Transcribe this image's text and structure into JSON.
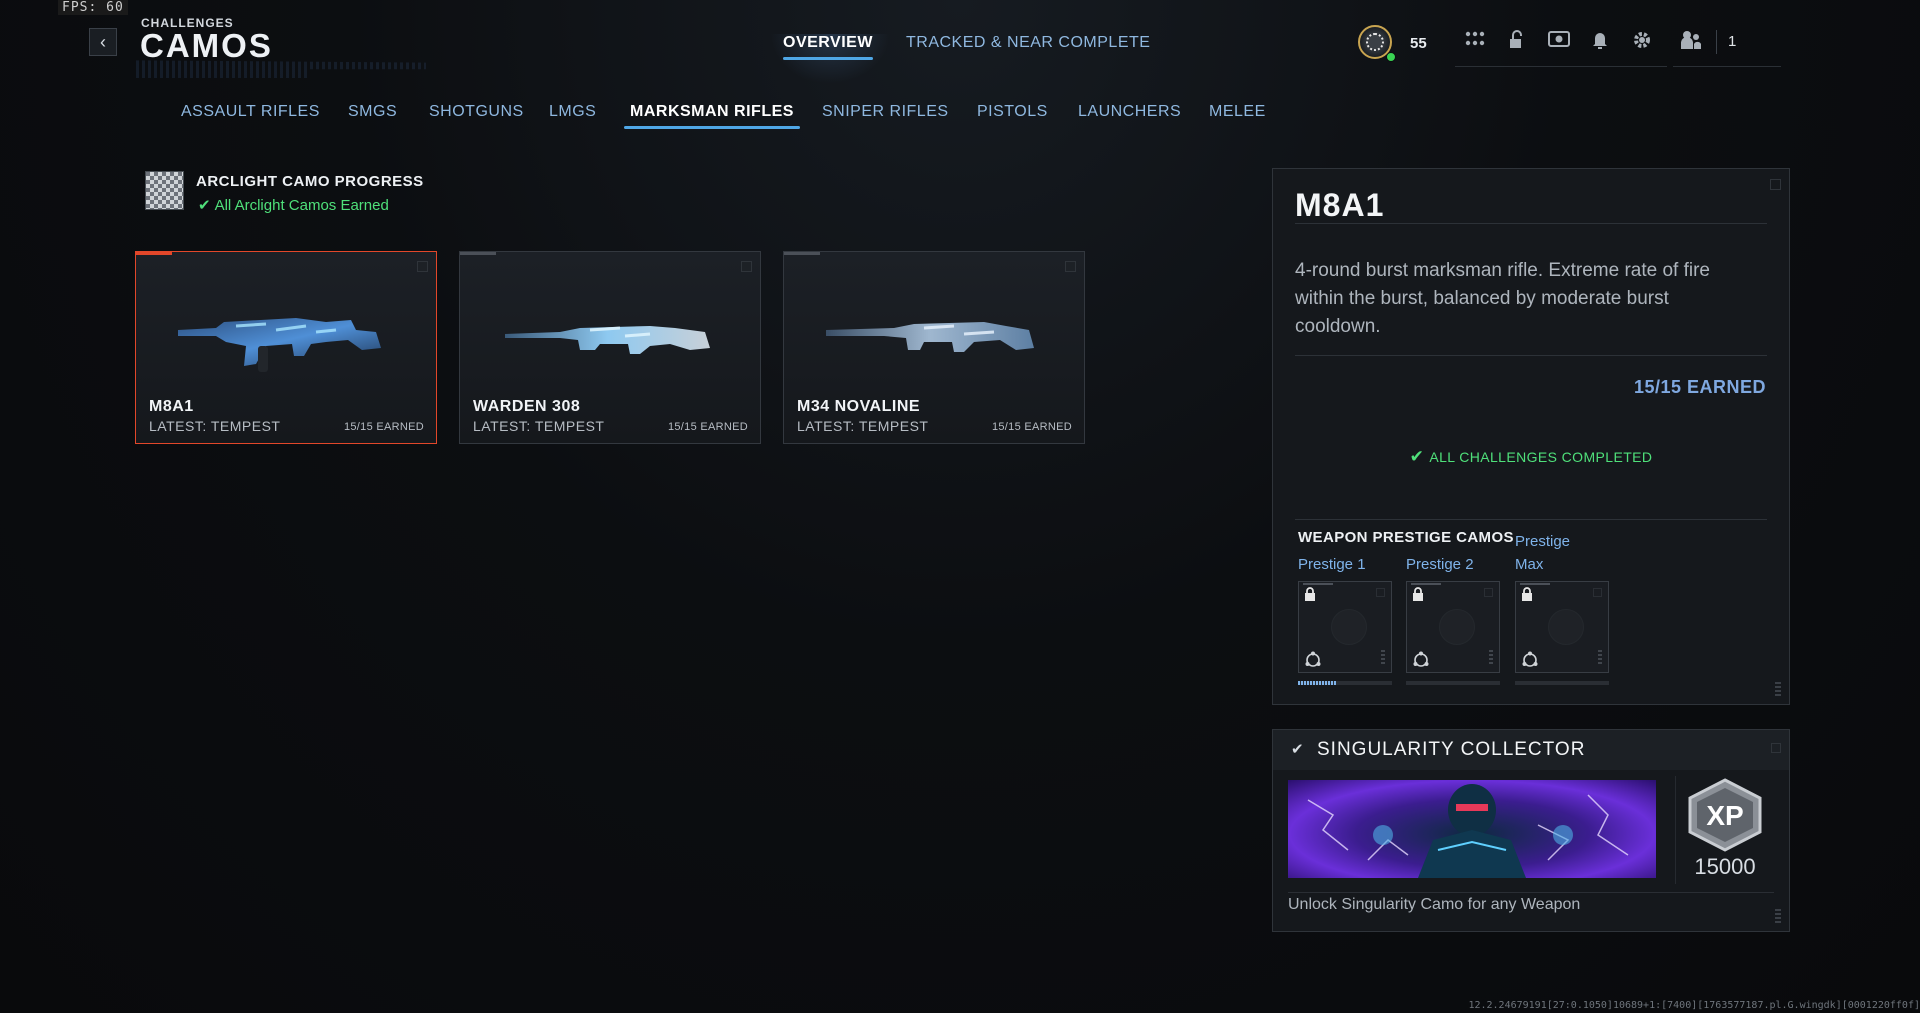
{
  "fps": "FPS: 60",
  "header": {
    "breadcrumb": "CHALLENGES",
    "title": "CAMOS",
    "back_glyph": "‹"
  },
  "top_tabs": [
    {
      "label": "OVERVIEW",
      "active": true
    },
    {
      "label": "TRACKED & NEAR COMPLETE",
      "active": false
    }
  ],
  "player": {
    "level": "55",
    "party_count": "1"
  },
  "header_icons": [
    "apps-grid-icon",
    "unlock-icon",
    "theater-icon",
    "notification-bell-icon",
    "settings-gear-icon",
    "party-icon"
  ],
  "categories": [
    {
      "label": "ASSAULT RIFLES",
      "active": false
    },
    {
      "label": "SMGS",
      "active": false
    },
    {
      "label": "SHOTGUNS",
      "active": false
    },
    {
      "label": "LMGS",
      "active": false
    },
    {
      "label": "MARKSMAN RIFLES",
      "active": true
    },
    {
      "label": "SNIPER RIFLES",
      "active": false
    },
    {
      "label": "PISTOLS",
      "active": false
    },
    {
      "label": "LAUNCHERS",
      "active": false
    },
    {
      "label": "MELEE",
      "active": false
    }
  ],
  "progress": {
    "title": "ARCLIGHT CAMO PROGRESS",
    "status": "All Arclight Camos Earned"
  },
  "weapons": [
    {
      "name": "M8A1",
      "latest": "LATEST: TEMPEST",
      "earned": "15/15 EARNED",
      "selected": true
    },
    {
      "name": "WARDEN 308",
      "latest": "LATEST: TEMPEST",
      "earned": "15/15 EARNED",
      "selected": false
    },
    {
      "name": "M34 NOVALINE",
      "latest": "LATEST: TEMPEST",
      "earned": "15/15 EARNED",
      "selected": false
    }
  ],
  "detail": {
    "name": "M8A1",
    "description": "4-round burst marksman rifle. Extreme rate of fire within the burst, balanced by moderate burst cooldown.",
    "earned": "15/15 EARNED",
    "complete": "ALL CHALLENGES COMPLETED",
    "prestige_heading": "WEAPON PRESTIGE CAMOS",
    "prestige": [
      {
        "label_line1": "Prestige 1",
        "label_line2": "",
        "progress": 0.4
      },
      {
        "label_line1": "Prestige 2",
        "label_line2": "",
        "progress": 0
      },
      {
        "label_line1": "Prestige",
        "label_line2": "Max",
        "progress": 0
      }
    ]
  },
  "reward": {
    "title": "SINGULARITY COLLECTOR",
    "xp_badge": "XP",
    "xp_value": "15000",
    "description": "Unlock Singularity Camo for any Weapon"
  },
  "build_info": "12.2.24679191[27:0.1050]10689+1:[7400][1763577187.pl.G.wingdk][0001220ff0f]",
  "colors": {
    "accent_blue": "#4fa7e6",
    "selected_red": "#e2472a",
    "complete_green": "#4fe07a",
    "earned_blue": "#7fa8e0"
  }
}
